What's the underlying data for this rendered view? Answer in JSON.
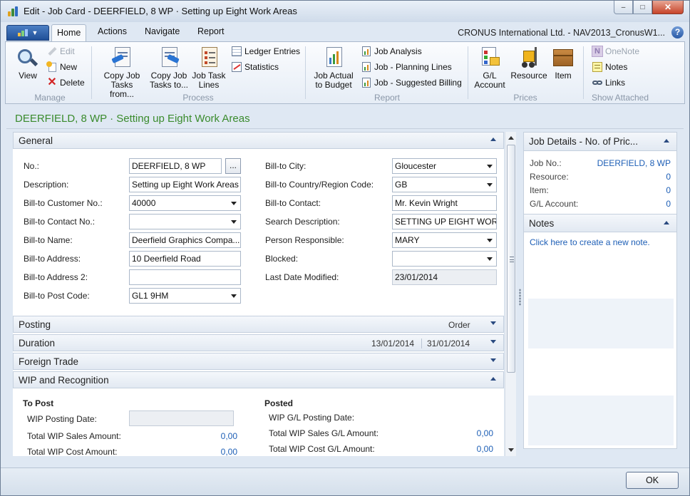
{
  "window": {
    "title": "Edit - Job Card - DEERFIELD, 8 WP · Setting up Eight Work Areas",
    "minimize_label": "–",
    "maximize_label": "□",
    "close_label": "✕"
  },
  "ribbon": {
    "tabs": [
      {
        "label": "Home",
        "active": true
      },
      {
        "label": "Actions"
      },
      {
        "label": "Navigate"
      },
      {
        "label": "Report"
      }
    ],
    "company": "CRONUS International Ltd. - NAV2013_CronusW1...",
    "help_label": "?",
    "groups": {
      "manage": {
        "label": "Manage",
        "view": "View",
        "edit": "Edit",
        "new": "New",
        "delete": "Delete"
      },
      "process": {
        "label": "Process",
        "copy_from_l1": "Copy Job",
        "copy_from_l2": "Tasks from...",
        "copy_to_l1": "Copy Job",
        "copy_to_l2": "Tasks to...",
        "task_lines_l1": "Job Task",
        "task_lines_l2": "Lines",
        "ledger_entries": "Ledger Entries",
        "statistics": "Statistics"
      },
      "report": {
        "label": "Report",
        "actual_l1": "Job Actual",
        "actual_l2": "to Budget",
        "job_analysis": "Job Analysis",
        "planning_lines": "Job - Planning Lines",
        "suggested_billing": "Job - Suggested Billing"
      },
      "prices": {
        "label": "Prices",
        "gl_l1": "G/L",
        "gl_l2": "Account",
        "resource": "Resource",
        "item": "Item"
      },
      "show_attached": {
        "label": "Show Attached",
        "onenote": "OneNote",
        "notes": "Notes",
        "links": "Links"
      }
    }
  },
  "page_title": "DEERFIELD, 8 WP · Setting up Eight Work Areas",
  "general": {
    "title": "General",
    "assist_label": "...",
    "left": [
      {
        "label": "No.:",
        "value": "DEERFIELD, 8 WP"
      },
      {
        "label": "Description:",
        "value": "Setting up Eight Work Areas"
      },
      {
        "label": "Bill-to Customer No.:",
        "value": "40000"
      },
      {
        "label": "Bill-to Contact No.:",
        "value": ""
      },
      {
        "label": "Bill-to Name:",
        "value": "Deerfield Graphics Compa..."
      },
      {
        "label": "Bill-to Address:",
        "value": "10 Deerfield Road"
      },
      {
        "label": "Bill-to Address 2:",
        "value": ""
      },
      {
        "label": "Bill-to Post Code:",
        "value": "GL1 9HM"
      }
    ],
    "right": [
      {
        "label": "Bill-to City:",
        "value": "Gloucester"
      },
      {
        "label": "Bill-to Country/Region Code:",
        "value": "GB"
      },
      {
        "label": "Bill-to Contact:",
        "value": "Mr. Kevin Wright"
      },
      {
        "label": "Search Description:",
        "value": "SETTING UP EIGHT WOR..."
      },
      {
        "label": "Person Responsible:",
        "value": "MARY"
      },
      {
        "label": "Blocked:",
        "value": ""
      },
      {
        "label": "Last Date Modified:",
        "value": "23/01/2014"
      }
    ]
  },
  "posting": {
    "title": "Posting",
    "summary": "Order"
  },
  "duration": {
    "title": "Duration",
    "start": "13/01/2014",
    "end": "31/01/2014"
  },
  "foreign_trade": {
    "title": "Foreign Trade"
  },
  "wip": {
    "title": "WIP and Recognition",
    "to_post": {
      "heading": "To Post",
      "posting_date_label": "WIP Posting Date:",
      "posting_date_value": "",
      "sales_label": "Total WIP Sales Amount:",
      "sales_value": "0,00",
      "cost_label": "Total WIP Cost Amount:",
      "cost_value": "0,00"
    },
    "posted": {
      "heading": "Posted",
      "gl_date_label": "WIP G/L Posting Date:",
      "sales_label": "Total WIP Sales G/L Amount:",
      "sales_value": "0,00",
      "cost_label": "Total WIP Cost G/L Amount:",
      "cost_value": "0,00"
    }
  },
  "factbox": {
    "job_details": {
      "title": "Job Details - No. of Pric...",
      "rows": [
        {
          "label": "Job No.:",
          "value": "DEERFIELD, 8 WP"
        },
        {
          "label": "Resource:",
          "value": "0"
        },
        {
          "label": "Item:",
          "value": "0"
        },
        {
          "label": "G/L Account:",
          "value": "0"
        }
      ]
    },
    "notes": {
      "title": "Notes",
      "link": "Click here to create a new note."
    }
  },
  "ok_label": "OK"
}
